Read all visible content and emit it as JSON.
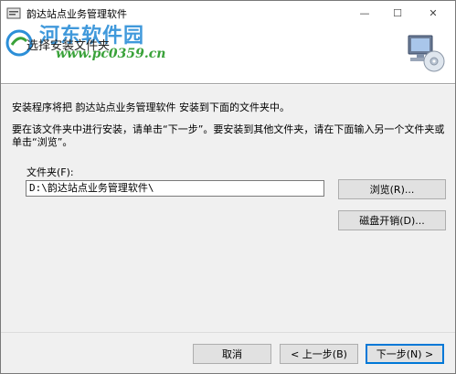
{
  "window": {
    "title": "韵达站点业务管理软件",
    "min_glyph": "—",
    "max_glyph": "☐",
    "close_glyph": "✕"
  },
  "header": {
    "step_title": "选择安装文件夹",
    "watermark_line1": "河东软件园",
    "watermark_line2": "www.pc0359.cn"
  },
  "content": {
    "intro": "安装程序将把 韵达站点业务管理软件 安装到下面的文件夹中。",
    "instructions": "要在该文件夹中进行安装，请单击“下一步”。要安装到其他文件夹，请在下面输入另一个文件夹或单击“浏览”。",
    "folder_label": "文件夹(F):",
    "folder_value": "D:\\韵达站点业务管理软件\\",
    "browse_label": "浏览(R)...",
    "disk_cost_label": "磁盘开销(D)..."
  },
  "footer": {
    "cancel_label": "取消",
    "back_label": "< 上一步(B)",
    "next_label": "下一步(N) >"
  },
  "colors": {
    "accent": "#0078d7",
    "watermark_blue": "#2c8fd8",
    "watermark_green": "#3aa23a"
  }
}
